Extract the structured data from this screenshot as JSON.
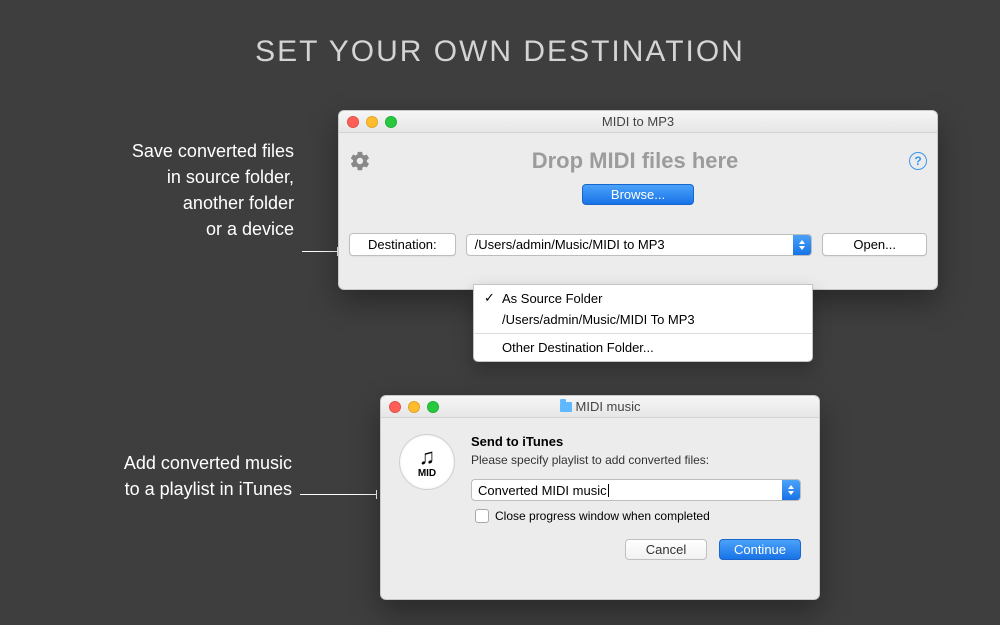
{
  "page": {
    "title": "SET YOUR OWN DESTINATION"
  },
  "callouts": {
    "save": "Save converted files\nin source folder,\nanother folder\nor a device",
    "playlist": "Add converted music\nto a playlist in iTunes"
  },
  "window1": {
    "title": "MIDI to MP3",
    "drop_text": "Drop MIDI files here",
    "browse_label": "Browse...",
    "destination_label": "Destination:",
    "destination_value": "/Users/admin/Music/MIDI to MP3",
    "open_label": "Open...",
    "menu": {
      "item1": "As Source Folder",
      "item2": "/Users/admin/Music/MIDI To MP3",
      "item3": "Other Destination Folder..."
    }
  },
  "window2": {
    "title": "MIDI music",
    "icon_label": "MID",
    "dialog_title": "Send to iTunes",
    "dialog_sub": "Please specify playlist to add converted files:",
    "playlist_value": "Converted MIDI music",
    "checkbox_label": "Close progress window when completed",
    "cancel_label": "Cancel",
    "continue_label": "Continue"
  }
}
